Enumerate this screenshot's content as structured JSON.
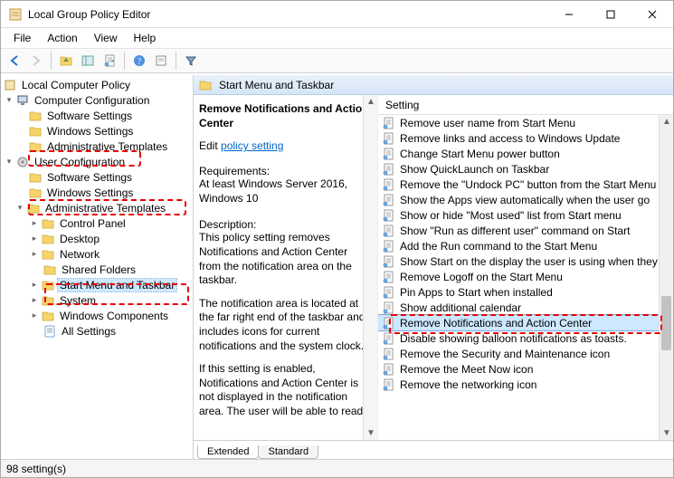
{
  "window": {
    "title": "Local Group Policy Editor"
  },
  "menu": {
    "items": [
      "File",
      "Action",
      "View",
      "Help"
    ]
  },
  "tree": {
    "root": "Local Computer Policy",
    "computer_config": "Computer Configuration",
    "cc_software": "Software Settings",
    "cc_windows": "Windows Settings",
    "cc_admin": "Administrative Templates",
    "user_config": "User Configuration",
    "uc_software": "Software Settings",
    "uc_windows": "Windows Settings",
    "uc_admin": "Administrative Templates",
    "control_panel": "Control Panel",
    "desktop": "Desktop",
    "network": "Network",
    "shared_folders": "Shared Folders",
    "start_menu": "Start Menu and Taskbar",
    "system": "System",
    "windows_components": "Windows Components",
    "all_settings": "All Settings"
  },
  "path_header": "Start Menu and Taskbar",
  "details": {
    "title": "Remove Notifications and Action Center",
    "edit_prefix": "Edit ",
    "edit_link": "policy setting",
    "req_label": "Requirements:",
    "req_text": "At least Windows Server 2016, Windows 10",
    "desc_label": "Description:",
    "desc_p1": "This policy setting removes Notifications and Action Center from the notification area on the taskbar.",
    "desc_p2": "The notification area is located at the far right end of the taskbar and includes icons for current notifications and the system clock.",
    "desc_p3": "If this setting is enabled, Notifications and Action Center is not displayed in the notification area. The user will be able to read"
  },
  "column_header": "Setting",
  "settings": [
    "Remove user name from Start Menu",
    "Remove links and access to Windows Update",
    "Change Start Menu power button",
    "Show QuickLaunch on Taskbar",
    "Remove the \"Undock PC\" button from the Start Menu",
    "Show the Apps view automatically when the user go",
    "Show or hide \"Most used\" list from Start menu",
    "Show \"Run as different user\" command on Start",
    "Add the Run command to the Start Menu",
    "Show Start on the display the user is using when they",
    "Remove Logoff on the Start Menu",
    "Pin Apps to Start when installed",
    "Show additional calendar",
    "Remove Notifications and Action Center",
    "Disable showing balloon notifications as toasts.",
    "Remove the Security and Maintenance icon",
    "Remove the Meet Now icon",
    "Remove the networking icon"
  ],
  "selected_setting_index": 13,
  "tabs": {
    "extended": "Extended",
    "standard": "Standard"
  },
  "status": "98 setting(s)"
}
